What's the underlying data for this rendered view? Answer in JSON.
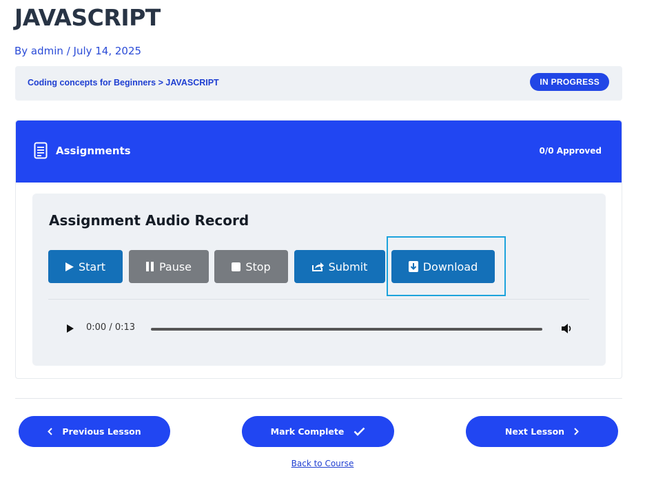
{
  "page": {
    "title": "JAVASCRIPT",
    "byline": "By admin / July 14, 2025"
  },
  "breadcrumb": {
    "text": "Coding concepts for Beginners > JAVASCRIPT",
    "status_badge": "IN PROGRESS"
  },
  "assignments": {
    "header_title": "Assignments",
    "approved_text": "0/0 Approved",
    "header_icon": "document-icon",
    "header_color": "#2146f2"
  },
  "recorder": {
    "title": "Assignment Audio Record",
    "buttons": [
      {
        "label": "Start",
        "icon": "play-icon",
        "color": "#1470b8"
      },
      {
        "label": "Pause",
        "icon": "pause-icon",
        "color": "#777b80"
      },
      {
        "label": "Stop",
        "icon": "stop-icon",
        "color": "#777b80"
      },
      {
        "label": "Submit",
        "icon": "share-icon",
        "color": "#1470b8"
      },
      {
        "label": "Download",
        "icon": "download-icon",
        "color": "#1470b8"
      }
    ],
    "highlighted_button": "Download"
  },
  "audio_player": {
    "time": "0:00 / 0:13",
    "progress": 0
  },
  "navigation": {
    "previous_label": "Previous Lesson",
    "complete_label": "Mark Complete",
    "next_label": "Next Lesson",
    "back_label": "Back to Course",
    "accent_color": "#2146f2"
  }
}
